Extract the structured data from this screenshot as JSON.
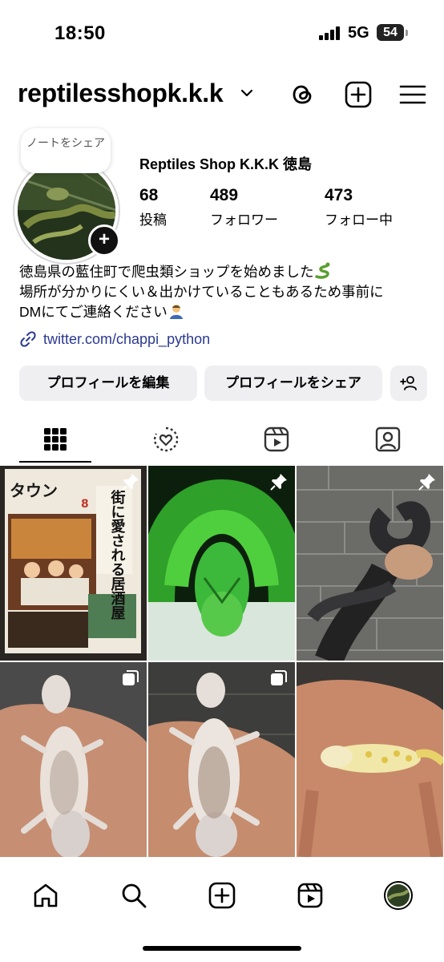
{
  "status_bar": {
    "time": "18:50",
    "network": "5G",
    "battery": "54"
  },
  "header": {
    "username": "reptilesshopk.k.k",
    "icons": [
      "chevron-down-icon",
      "threads-icon",
      "create-post-icon",
      "menu-icon"
    ]
  },
  "profile": {
    "note_bubble": "ノートをシェア",
    "display_name": "Reptiles Shop K.K.K 徳島",
    "stats": [
      {
        "value": "68",
        "label": "投稿"
      },
      {
        "value": "489",
        "label": "フォロワー"
      },
      {
        "value": "473",
        "label": "フォロー中"
      }
    ],
    "bio_lines": [
      "徳島県の藍住町で爬虫類ショップを始めました",
      "場所が分かりにくい＆出かけていることもあるため事前に",
      "DMにてご連絡ください"
    ],
    "link": "twitter.com/chappi_python"
  },
  "actions": {
    "edit_profile": "プロフィールを編集",
    "share_profile": "プロフィールをシェア",
    "discover_icon": "add-person-icon"
  },
  "tabs": [
    "grid-icon",
    "reels-remix-icon",
    "reels-icon",
    "tagged-icon"
  ],
  "posts": [
    {
      "subject": "magazine cover",
      "badge": "pin-icon",
      "magazine_title": "タウン",
      "magazine_headline": "街に愛される居酒屋",
      "issue": "8"
    },
    {
      "subject": "green tree python",
      "badge": "pin-icon"
    },
    {
      "subject": "black snake on hand",
      "badge": "pin-icon"
    },
    {
      "subject": "gecko on hand",
      "badge": "carousel-icon"
    },
    {
      "subject": "gecko on hand",
      "badge": "carousel-icon"
    },
    {
      "subject": "leopard gecko on hand",
      "badge": "none"
    }
  ],
  "bottom_nav": [
    "home-icon",
    "search-icon",
    "create-icon",
    "reels-icon",
    "profile-avatar"
  ],
  "colors": {
    "link": "#2b3a8f",
    "button_bg": "#efeff2",
    "text": "#000000"
  }
}
